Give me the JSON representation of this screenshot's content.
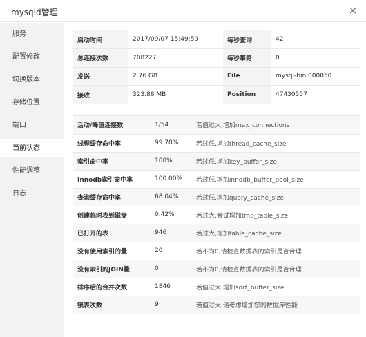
{
  "window": {
    "title": "mysqld管理",
    "close_icon": "×"
  },
  "sidebar": {
    "items": [
      {
        "label": "服务",
        "active": false
      },
      {
        "label": "配置修改",
        "active": false
      },
      {
        "label": "切换版本",
        "active": false
      },
      {
        "label": "存储位置",
        "active": false
      },
      {
        "label": "端口",
        "active": false
      },
      {
        "label": "当前状态",
        "active": true
      },
      {
        "label": "性能调整",
        "active": false
      },
      {
        "label": "日志",
        "active": false
      }
    ]
  },
  "status_overview": {
    "rows": [
      {
        "k1": "启动时间",
        "v1": "2017/09/07 15:49:59",
        "k2": "每秒查询",
        "v2": "42"
      },
      {
        "k1": "总连接次数",
        "v1": "708227",
        "k2": "每秒事务",
        "v2": "0"
      },
      {
        "k1": "发送",
        "v1": "2.76 GB",
        "k2": "File",
        "v2": "mysql-bin.000050"
      },
      {
        "k1": "接收",
        "v1": "323.88 MB",
        "k2": "Position",
        "v2": "47430557"
      }
    ]
  },
  "performance": {
    "rows": [
      {
        "name": "活动/峰值连接数",
        "value": "1/54",
        "tip": "若值过大,增加max_connections"
      },
      {
        "name": "线程缓存命中率",
        "value": "99.78%",
        "tip": "若过低,增加thread_cache_size"
      },
      {
        "name": "索引命中率",
        "value": "100%",
        "tip": "若过低,增加key_buffer_size"
      },
      {
        "name": "Innodb索引命中率",
        "value": "100.00%",
        "tip": "若过低,增加innodb_buffer_pool_size"
      },
      {
        "name": "查询缓存命中率",
        "value": "68.04%",
        "tip": "若过低,增加query_cache_size"
      },
      {
        "name": "创建临时表到磁盘",
        "value": "0.42%",
        "tip": "若过大,尝试增加tmp_table_size"
      },
      {
        "name": "已打开的表",
        "value": "946",
        "tip": "若过大,增加table_cache_size"
      },
      {
        "name": "没有使用索引的量",
        "value": "20",
        "tip": "若不为0,请检查数据表的索引是否合理"
      },
      {
        "name": "没有索引的JOIN量",
        "value": "0",
        "tip": "若不为0,请检查数据表的索引是否合理"
      },
      {
        "name": "排序后的合并次数",
        "value": "1846",
        "tip": "若值过大,增加sort_buffer_size"
      },
      {
        "name": "锁表次数",
        "value": "9",
        "tip": "若值过大,请考虑增加您的数据库性能"
      }
    ]
  }
}
